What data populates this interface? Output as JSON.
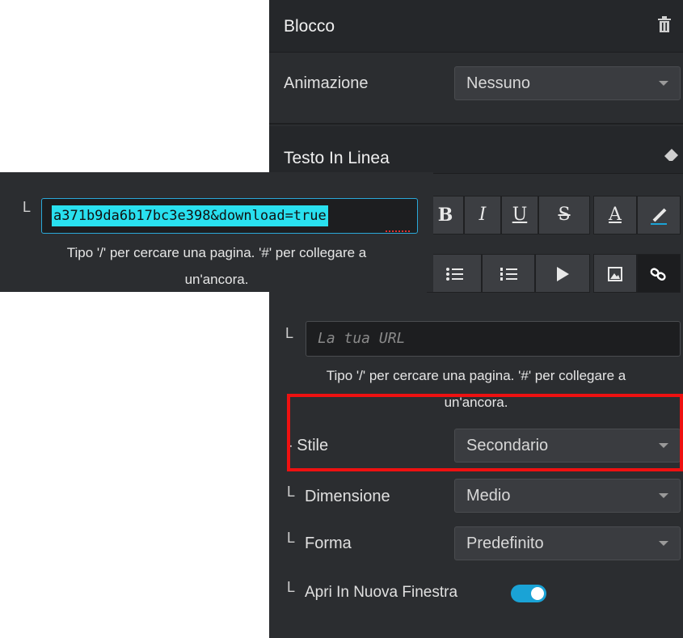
{
  "block": {
    "title": "Blocco",
    "delete_icon": "trash-icon"
  },
  "animation": {
    "label": "Animazione",
    "value": "Nessuno"
  },
  "inline_text": {
    "title": "Testo In Linea",
    "eraser_icon": "eraser-icon"
  },
  "toolbar": {
    "bold": "B",
    "italic": "I",
    "underline": "U",
    "strike": "S",
    "font_color": "A",
    "highlight_icon": "brush-icon",
    "bullet_list_icon": "bullet-list-icon",
    "numbered_list_icon": "numbered-list-icon",
    "play_icon": "play-icon",
    "image_icon": "image-icon",
    "link_icon": "link-icon"
  },
  "url": {
    "lmark": "L",
    "placeholder": "La tua URL",
    "hint_line1": "Tipo '/' per cercare una pagina. '#' per collegare a",
    "hint_line2": "un'ancora."
  },
  "style": {
    "label": "- Stile",
    "value": "Secondario"
  },
  "size": {
    "lmark": "L",
    "label": "Dimensione",
    "value": "Medio"
  },
  "shape": {
    "lmark": "L",
    "label": "Forma",
    "value": "Predefinito"
  },
  "new_window": {
    "lmark": "L",
    "label": "Apri In Nuova Finestra",
    "enabled": true
  },
  "popup": {
    "lmark": "L",
    "url_value": "a371b9da6b17bc3e398&download=true",
    "hint_line1": "Tipo '/' per cercare una pagina. '#' per collegare a",
    "hint_line2": "un'ancora."
  },
  "colors": {
    "accent": "#1aa3d6",
    "selection": "#29e0ef",
    "highlight_box": "#ee1111"
  }
}
